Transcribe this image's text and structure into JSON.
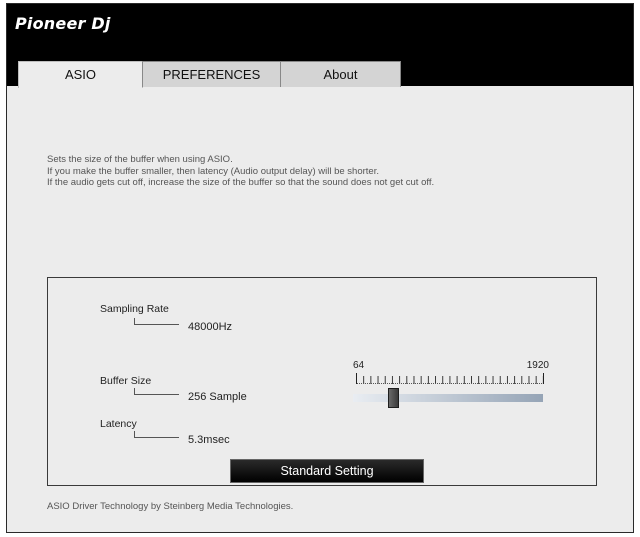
{
  "brand": {
    "logo_text": "Pioneer Dj"
  },
  "tabs": [
    {
      "label": "ASIO",
      "active": true
    },
    {
      "label": "PREFERENCES",
      "active": false
    },
    {
      "label": "About",
      "active": false
    }
  ],
  "description": {
    "lines": [
      "Sets the size of the buffer when using ASIO.",
      "If you make the buffer smaller, then latency (Audio output delay) will be shorter.",
      "If the audio gets cut off, increase the size of the buffer so that the sound does not get cut off."
    ]
  },
  "settings": {
    "sampling_rate": {
      "label": "Sampling Rate",
      "value": "48000Hz"
    },
    "buffer_size": {
      "label": "Buffer Size",
      "value": "256 Sample",
      "slider": {
        "min_label": "64",
        "max_label": "1920",
        "min": 64,
        "max": 1920,
        "current": 256
      }
    },
    "latency": {
      "label": "Latency",
      "value": "5.3msec"
    },
    "standard_button_label": "Standard Setting"
  },
  "footer": {
    "text": "ASIO Driver Technology by Steinberg Media Technologies."
  },
  "colors": {
    "header_bg": "#000000",
    "panel_bg": "#ececec",
    "button_bg": "#000000"
  }
}
